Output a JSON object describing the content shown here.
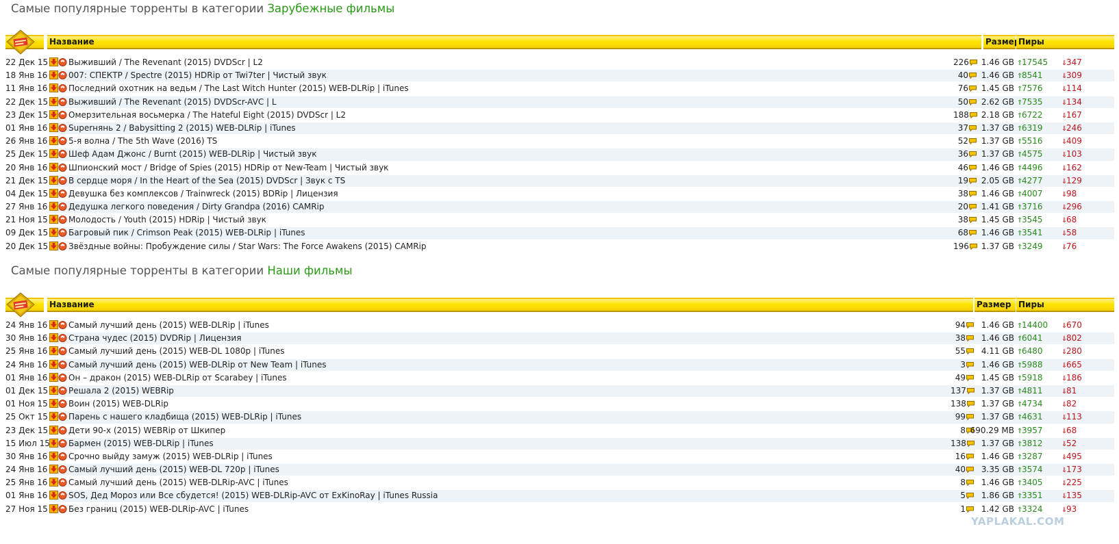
{
  "sections": [
    {
      "title_prefix": "Самые популярные торренты в категории",
      "category": "Зарубежные фильмы",
      "col_name": "Название",
      "col_size": "Размер",
      "col_peers": "Пиры",
      "rows": [
        {
          "date": "22 Дек 15",
          "name": "Выживший / The Revenant (2015) DVDScr | L2",
          "comments": "226",
          "size": "1.46 GB",
          "seeds": "17545",
          "leech": "347"
        },
        {
          "date": "18 Янв 16",
          "name": "007: СПЕКТР / Spectre (2015) HDRip от Twi7ter | Чистый звук",
          "comments": "40",
          "size": "1.46 GB",
          "seeds": "8541",
          "leech": "309"
        },
        {
          "date": "11 Янв 16",
          "name": "Последний охотник на ведьм / The Last Witch Hunter (2015) WEB-DLRip | iTunes",
          "comments": "76",
          "size": "1.45 GB",
          "seeds": "7576",
          "leech": "114"
        },
        {
          "date": "22 Дек 15",
          "name": "Выживший / The Revenant (2015) DVDScr-AVC | L",
          "comments": "50",
          "size": "2.62 GB",
          "seeds": "7535",
          "leech": "134"
        },
        {
          "date": "23 Дек 15",
          "name": "Омерзительная восьмерка / The Hateful Eight (2015) DVDScr | L2",
          "comments": "188",
          "size": "2.18 GB",
          "seeds": "6722",
          "leech": "167"
        },
        {
          "date": "01 Янв 16",
          "name": "Superнянь 2 / Babysitting 2 (2015) WEB-DLRip | iTunes",
          "comments": "37",
          "size": "1.37 GB",
          "seeds": "6319",
          "leech": "246"
        },
        {
          "date": "26 Янв 16",
          "name": "5-я волна / The 5th Wave (2016) TS",
          "comments": "52",
          "size": "1.37 GB",
          "seeds": "5516",
          "leech": "409"
        },
        {
          "date": "25 Дек 15",
          "name": "Шеф Адам Джонс / Burnt (2015) WEB-DLRip | Чистый звук",
          "comments": "36",
          "size": "1.37 GB",
          "seeds": "4575",
          "leech": "103"
        },
        {
          "date": "20 Янв 16",
          "name": "Шпионский мост / Bridge of Spies (2015) HDRip от New-Team | Чистый звук",
          "comments": "46",
          "size": "1.46 GB",
          "seeds": "4496",
          "leech": "162"
        },
        {
          "date": "21 Дек 15",
          "name": "В сердце моря / In the Heart of the Sea (2015) DVDScr | Звук с TS",
          "comments": "19",
          "size": "2.05 GB",
          "seeds": "4277",
          "leech": "129"
        },
        {
          "date": "04 Дек 15",
          "name": "Девушка без комплексов / Trainwreck (2015) BDRip | Лицензия",
          "comments": "38",
          "size": "1.46 GB",
          "seeds": "4007",
          "leech": "98"
        },
        {
          "date": "27 Янв 16",
          "name": "Дедушка легкого поведения / Dirty Grandpa (2016) CAMRip",
          "comments": "20",
          "size": "1.41 GB",
          "seeds": "3716",
          "leech": "296"
        },
        {
          "date": "21 Ноя 15",
          "name": "Молодость / Youth (2015) HDRip | Чистый звук",
          "comments": "38",
          "size": "1.45 GB",
          "seeds": "3545",
          "leech": "68"
        },
        {
          "date": "09 Дек 15",
          "name": "Багровый пик / Crimson Peak (2015) WEB-DLRip | iTunes",
          "comments": "68",
          "size": "1.46 GB",
          "seeds": "3541",
          "leech": "58"
        },
        {
          "date": "20 Дек 15",
          "name": "Звёздные войны: Пробуждение силы / Star Wars: The Force Awakens (2015) CAMRip",
          "comments": "196",
          "size": "1.37 GB",
          "seeds": "3249",
          "leech": "76"
        }
      ]
    },
    {
      "title_prefix": "Самые популярные торренты в категории",
      "category": "Наши фильмы",
      "col_name": "Название",
      "col_size": "Размер",
      "col_peers": "Пиры",
      "rows": [
        {
          "date": "24 Янв 16",
          "name": "Самый лучший день (2015) WEB-DLRip | iTunes",
          "comments": "94",
          "size": "1.46 GB",
          "seeds": "14400",
          "leech": "670"
        },
        {
          "date": "30 Янв 16",
          "name": "Страна чудес (2015) DVDRip | Лицензия",
          "comments": "38",
          "size": "1.46 GB",
          "seeds": "6041",
          "leech": "802"
        },
        {
          "date": "25 Янв 16",
          "name": "Самый лучший день (2015) WEB-DL 1080p | iTunes",
          "comments": "55",
          "size": "4.11 GB",
          "seeds": "6480",
          "leech": "280"
        },
        {
          "date": "24 Янв 16",
          "name": "Самый лучший день (2015) WEB-DLRip от New Team | iTunes",
          "comments": "3",
          "size": "1.46 GB",
          "seeds": "5988",
          "leech": "665"
        },
        {
          "date": "01 Янв 16",
          "name": "Он – дракон (2015) WEB-DLRip от Scarabey | iTunes",
          "comments": "49",
          "size": "1.45 GB",
          "seeds": "5918",
          "leech": "186"
        },
        {
          "date": "01 Дек 15",
          "name": "Решала 2 (2015) WEBRip",
          "comments": "137",
          "size": "1.37 GB",
          "seeds": "4811",
          "leech": "81"
        },
        {
          "date": "01 Ноя 15",
          "name": "Воин (2015) WEB-DLRip",
          "comments": "138",
          "size": "1.37 GB",
          "seeds": "4734",
          "leech": "82"
        },
        {
          "date": "25 Окт 15",
          "name": "Парень с нашего кладбища (2015) WEB-DLRip | iTunes",
          "comments": "99",
          "size": "1.37 GB",
          "seeds": "4631",
          "leech": "113"
        },
        {
          "date": "23 Дек 15",
          "name": "Дети 90-х (2015) WEBRip от Шкипер",
          "comments": "8",
          "size": "690.29 MB",
          "seeds": "3957",
          "leech": "68"
        },
        {
          "date": "15 Июл 15",
          "name": "Бармен (2015) WEB-DLRip | iTunes",
          "comments": "138",
          "size": "1.37 GB",
          "seeds": "3812",
          "leech": "52"
        },
        {
          "date": "30 Янв 16",
          "name": "Срочно выйду замуж (2015) WEB-DLRip | iTunes",
          "comments": "16",
          "size": "1.46 GB",
          "seeds": "3287",
          "leech": "495"
        },
        {
          "date": "24 Янв 16",
          "name": "Самый лучший день (2015) WEB-DL 720p | iTunes",
          "comments": "40",
          "size": "3.35 GB",
          "seeds": "3574",
          "leech": "173"
        },
        {
          "date": "25 Янв 16",
          "name": "Самый лучший день (2015) WEB-DLRip-AVC | iTunes",
          "comments": "8",
          "size": "1.46 GB",
          "seeds": "3405",
          "leech": "225"
        },
        {
          "date": "01 Янв 16",
          "name": "SOS, Дед Мороз или Все сбудется! (2015) WEB-DLRip-AVC от ExKinoRay | iTunes Russia",
          "comments": "5",
          "size": "1.86 GB",
          "seeds": "3351",
          "leech": "135"
        },
        {
          "date": "27 Ноя 15",
          "name": "Без границ (2015) WEB-DLRip-AVC | iTunes",
          "comments": "1",
          "size": "1.42 GB",
          "seeds": "3324",
          "leech": "93"
        }
      ]
    }
  ],
  "watermark": "YAPLAKAL.COM",
  "colors": {
    "header_yellow": "#ffe500",
    "category_green": "#2a9a17",
    "seeders_green": "#2a8a1e",
    "leechers_red": "#c0151b",
    "row_alt": "#edf3f7"
  },
  "icons": [
    "download-icon",
    "magnet-icon",
    "comment-icon",
    "arrow-up-icon",
    "arrow-down-icon",
    "logo-icon"
  ]
}
